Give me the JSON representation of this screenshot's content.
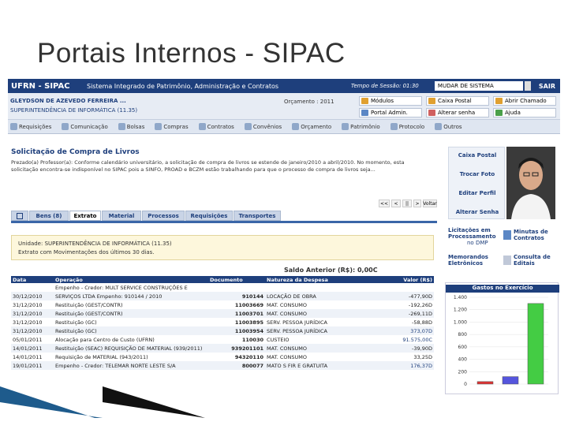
{
  "slide_title": "Portais Internos - SIPAC",
  "header": {
    "system": "UFRN - SIPAC",
    "system_name": "Sistema Integrado de Patrimônio, Administração e Contratos",
    "session": "Tempo de Sessão: 01:30",
    "unit_select": "MUDAR DE SISTEMA",
    "exit": "SAIR"
  },
  "user": {
    "name": "GLEYDSON DE AZEVEDO FERREIRA ...",
    "unit": "SUPERINTENDÊNCIA DE INFORMÁTICA (11.35)",
    "budget": "Orçamento : 2011"
  },
  "quick_buttons": [
    {
      "label": "Módulos",
      "color": "#e0a030"
    },
    {
      "label": "Caixa Postal",
      "color": "#d9b34a"
    },
    {
      "label": "Abrir Chamado",
      "color": "#e0a030"
    },
    {
      "label": "Portal Admin.",
      "color": "#5b87c5"
    },
    {
      "label": "Alterar senha",
      "color": "#d06060"
    },
    {
      "label": "Ajuda",
      "color": "#4aa04a"
    }
  ],
  "menu": [
    "Requisições",
    "Comunicação",
    "Bolsas",
    "Compras",
    "Contratos",
    "Convênios",
    "Orçamento",
    "Patrimônio",
    "Protocolo",
    "Outros"
  ],
  "notice": {
    "title": "Solicitação de Compra de Livros",
    "text": "Prezado(a) Professor(a): Conforme calendário universitário, a solicitação de compra de livros se estende de janeiro/2010 a abril/2010. No momento, esta solicitação encontra-se indisponível no SIPAC pois a SINFO, PROAD e BCZM estão trabalhando para que o processo de compra de livros seja...",
    "pager": [
      "<<",
      "<",
      "||",
      ">",
      "Voltar"
    ]
  },
  "tabs": [
    "Bens (8)",
    "Extrato",
    "Material",
    "Processos",
    "Requisições",
    "Transportes"
  ],
  "unit_box": {
    "line1": "Unidade: SUPERINTENDÊNCIA DE INFORMÁTICA (11.35)",
    "line2": "Extrato com Movimentações dos últimos 30 dias."
  },
  "saldo": "Saldo Anterior (R$): 0,00C",
  "table": {
    "headers": [
      "Data",
      "Operação",
      "Documento",
      "Natureza da Despesa",
      "Valor (R$)"
    ],
    "rows": [
      {
        "date": "",
        "op": "Empenho - Credor: MULT SERVICE CONSTRUÇÕES E",
        "doc": "",
        "nat": "",
        "val": ""
      },
      {
        "date": "30/12/2010",
        "op": "SERVIÇOS LTDA  Empenho: 910144 / 2010",
        "doc": "910144",
        "nat": "LOCAÇÃO DE OBRA",
        "val": "-477,90D"
      },
      {
        "date": "31/12/2010",
        "op": "Restituição (GEST/CONTR)",
        "doc": "11003669",
        "nat": "MAT. CONSUMO",
        "val": "-192,26D"
      },
      {
        "date": "31/12/2010",
        "op": "Restituição (GEST/CONTR)",
        "doc": "11003701",
        "nat": "MAT. CONSUMO",
        "val": "-269,11D"
      },
      {
        "date": "31/12/2010",
        "op": "Restituição (GC)",
        "doc": "11003895",
        "nat": "SERV. PESSOA JURÍDICA",
        "val": "-58,88D"
      },
      {
        "date": "31/12/2010",
        "op": "Restituição (GC)",
        "doc": "11003954",
        "nat": "SERV. PESSOA JURÍDICA",
        "val": "373,07D"
      },
      {
        "date": "05/01/2011",
        "op": "Alocação para Centro de Custo (UFRN)",
        "doc": "110030",
        "nat": "CUSTEIO",
        "val": "91.575,00C"
      },
      {
        "date": "14/01/2011",
        "op": "Restituição (SEAC) REQUISIÇÃO DE MATERIAL (939/2011)",
        "doc": "939201101",
        "nat": "MAT. CONSUMO",
        "val": "-39,90D"
      },
      {
        "date": "14/01/2011",
        "op": "Requisição de MATERIAL (943/2011)",
        "doc": "94320110",
        "nat": "MAT. CONSUMO",
        "val": "33,25D"
      },
      {
        "date": "19/01/2011",
        "op": "Empenho - Credor: TELEMAR NORTE LESTE S/A",
        "doc": "800077",
        "nat": "MATO S FIR E GRATUITA",
        "val": "176,37D"
      }
    ]
  },
  "right_links": [
    "Caixa Postal",
    "Trocar Foto",
    "Editar Perfil",
    "Alterar Senha"
  ],
  "licitacoes": {
    "a": "Licitações em Processamento",
    "b": "no DMP",
    "c": "Minutas de Contratos",
    "d": "Memorandos Eletrônicos",
    "e": "Consulta de Editais"
  },
  "chart_data": {
    "type": "bar",
    "title": "Gastos no Exercício",
    "ylim": [
      0,
      1400
    ],
    "yticks": [
      "1.400",
      "1.200",
      "1.000",
      "800",
      "600",
      "400",
      "200",
      "0"
    ],
    "series": [
      {
        "values": [
          40,
          120,
          1300
        ],
        "colors": [
          "#d33",
          "#55d",
          "#4c4"
        ]
      }
    ]
  }
}
